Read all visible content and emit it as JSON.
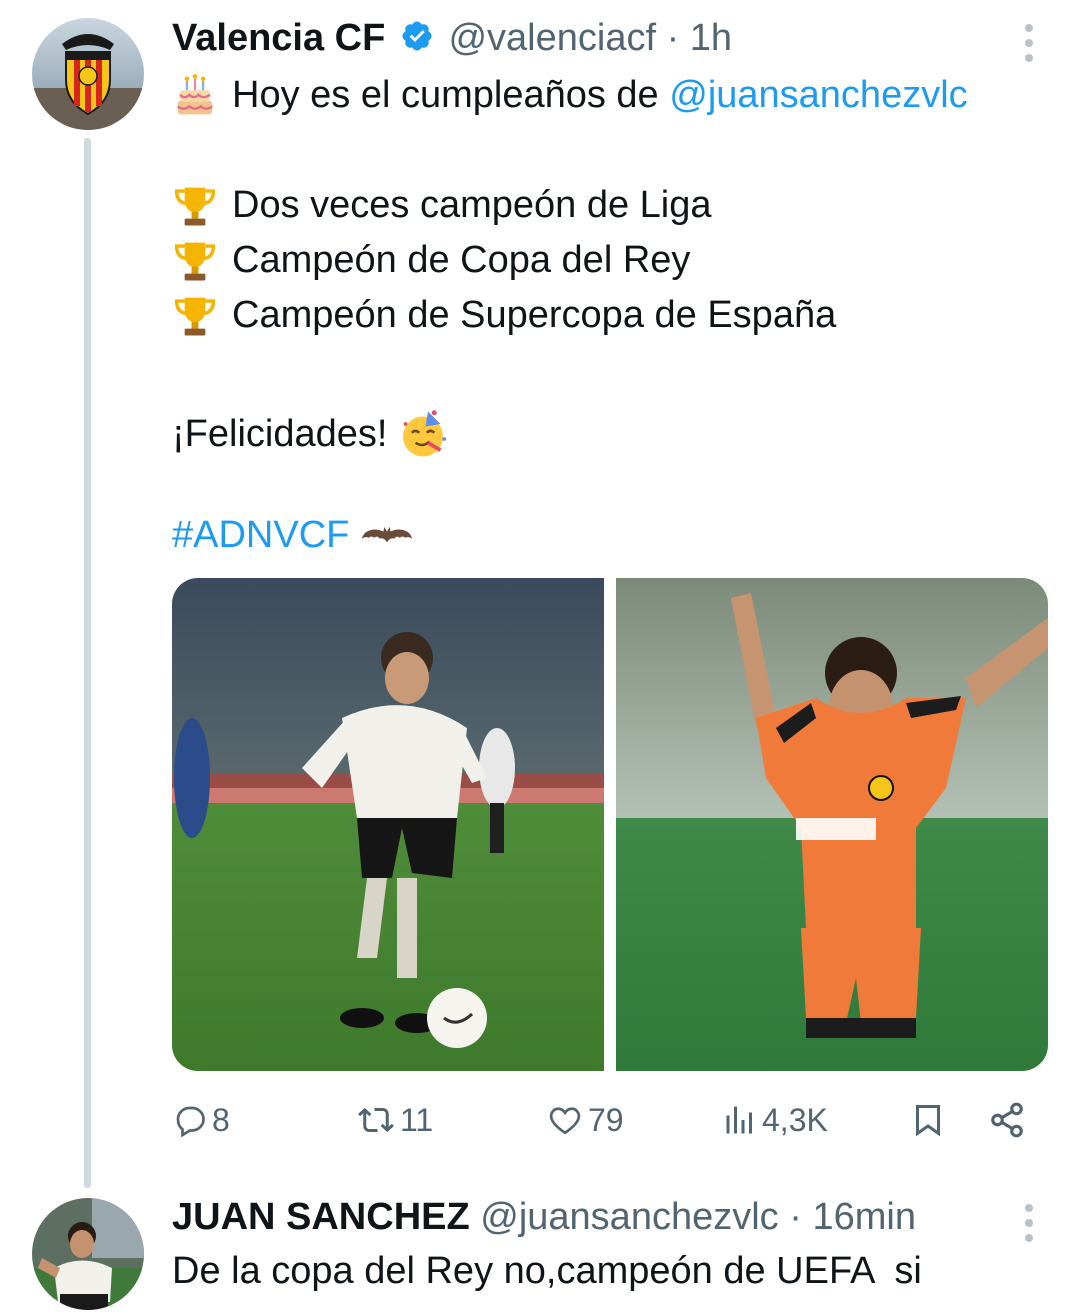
{
  "tweet": {
    "display_name": "Valencia CF",
    "handle": "@valenciacf",
    "separator": "·",
    "time": "1h",
    "verified_icon": "verified-badge-icon",
    "birthday_intro": "Hoy es el cumpleaños de",
    "mention": "@juansanchezvlc",
    "achievements": [
      "Dos veces campeón de Liga",
      "Campeón de Copa del Rey",
      "Campeón de Supercopa de España"
    ],
    "congrats": "¡Felicidades!",
    "hashtag": "#ADNVCF",
    "media": [
      {
        "icon": "photo-player-white-kit"
      },
      {
        "icon": "photo-player-orange-kit"
      }
    ],
    "metrics": {
      "replies": "8",
      "retweets": "11",
      "likes": "79",
      "views": "4,3K"
    }
  },
  "reply": {
    "display_name": "JUAN SANCHEZ",
    "handle": "@juansanchezvlc",
    "separator": "·",
    "time": "16min",
    "text": "De la copa del Rey no,campeón de UEFA  si"
  },
  "colors": {
    "accent": "#1d9bf0",
    "text": "#0f1419",
    "muted": "#536471",
    "thread_line": "#cfd9de"
  }
}
